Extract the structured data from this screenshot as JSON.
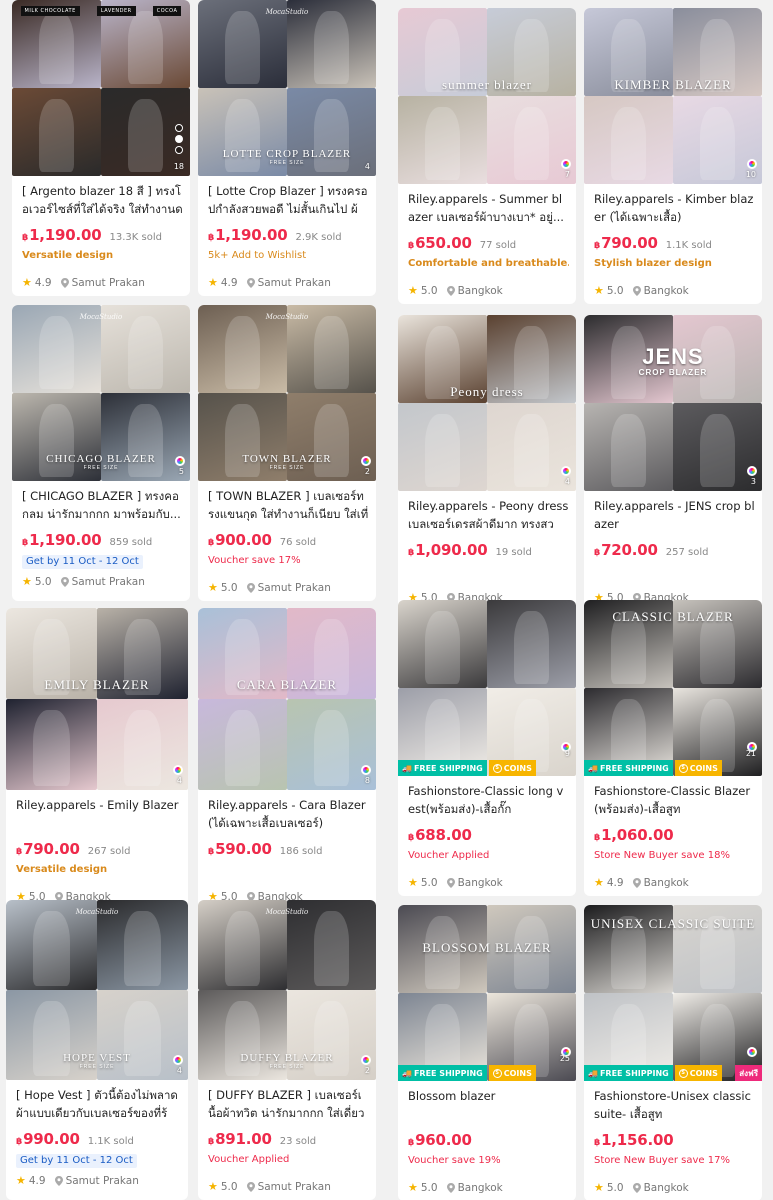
{
  "products": [
    {
      "title": "[ Argento blazer 18 สี ] ทรงโอเวอร์ไซส์ที่ใส่ได้จริง ใส่ทำงานดู...",
      "price_currency": "฿",
      "price": "1,190.00",
      "sold": "13.3K sold",
      "promo": "Versatile design",
      "rating": "4.9",
      "location": "Samut Prakan",
      "img_count": "18",
      "img_tags": [
        "MILK CHOCOLATE",
        "LAVENDER",
        "COCOA"
      ]
    },
    {
      "title": "[ Lotte Crop Blazer ] ทรงครอปกำลังสวยพอดี ไม่สั้นเกินไป ผ้า...",
      "price_currency": "฿",
      "price": "1,190.00",
      "sold": "2.9K sold",
      "promo": "5k+ Add to Wishlist",
      "rating": "4.9",
      "location": "Samut Prakan",
      "img_count": "4",
      "img_brand": "MocaStudio",
      "img_label": "LOTTE CROP BLAZER",
      "img_sub": "FREE SIZE"
    },
    {
      "title": "Riley.apparels - Summer blazer เบลเซอร์ผ้าบางเบา* อยู่...",
      "price_currency": "฿",
      "price": "650.00",
      "sold": "77 sold",
      "promo": "Comfortable and breathable...",
      "rating": "5.0",
      "location": "Bangkok",
      "img_count": "7",
      "img_label": "summer blazer"
    },
    {
      "title": "Riley.apparels - Kimber blazer (ได้เฉพาะเสื้อ)",
      "price_currency": "฿",
      "price": "790.00",
      "sold": "1.1K sold",
      "promo": "Stylish blazer design",
      "rating": "5.0",
      "location": "Bangkok",
      "img_count": "10",
      "img_label": "KIMBER BLAZER"
    },
    {
      "title": "[ CHICAGO BLAZER ] ทรงคอกลม น่ารักมากกก มาพร้อมกับ...",
      "price_currency": "฿",
      "price": "1,190.00",
      "sold": "859 sold",
      "promo": "Get by 11 Oct - 12 Oct",
      "rating": "5.0",
      "location": "Samut Prakan",
      "img_count": "5",
      "img_brand": "MocaStudio",
      "img_label": "CHICAGO BLAZER",
      "img_sub": "FREE SIZE"
    },
    {
      "title": "[ TOWN BLAZER ] เบลเซอร์ทรงแขนกุด ใส่ทำงานก็เนียบ ใส่เที่ยว...",
      "price_currency": "฿",
      "price": "900.00",
      "sold": "76 sold",
      "promo": "Voucher save 17%",
      "rating": "5.0",
      "location": "Samut Prakan",
      "img_count": "2",
      "img_brand": "MocaStudio",
      "img_label": "TOWN BLAZER",
      "img_sub": "FREE SIZE"
    },
    {
      "title": "Riley.apparels - Peony dress เบลเซอร์เดรสผ้าดีมาก ทรงสวย...",
      "price_currency": "฿",
      "price": "1,090.00",
      "sold": "19 sold",
      "promo": "",
      "rating": "5.0",
      "location": "Bangkok",
      "img_count": "4",
      "img_label": "Peony dress"
    },
    {
      "title": "Riley.apparels - JENS crop blazer",
      "price_currency": "฿",
      "price": "720.00",
      "sold": "257 sold",
      "promo": "",
      "rating": "5.0",
      "location": "Bangkok",
      "img_count": "3",
      "img_label": "JENS",
      "img_sub": "CROP BLAZER"
    },
    {
      "title": "Riley.apparels - Emily Blazer",
      "price_currency": "฿",
      "price": "790.00",
      "sold": "267 sold",
      "promo": "Versatile design",
      "rating": "5.0",
      "location": "Bangkok",
      "img_count": "4",
      "img_label": "EMILY BLAZER"
    },
    {
      "title": "Riley.apparels - Cara Blazer (ได้เฉพาะเสื้อเบลเซอร์)",
      "price_currency": "฿",
      "price": "590.00",
      "sold": "186 sold",
      "promo": "",
      "rating": "5.0",
      "location": "Bangkok",
      "img_count": "8",
      "img_label": "CARA BLAZER"
    },
    {
      "title": "Fashionstore-Classic long vest(พร้อมส่ง)-เสื้อกั๊ก",
      "price_currency": "฿",
      "price": "688.00",
      "sold": "",
      "promo": "Voucher Applied",
      "rating": "5.0",
      "location": "Bangkok",
      "img_count": "9",
      "badge_free": "FREE SHIPPING",
      "badge_coins": "COINS"
    },
    {
      "title": "Fashionstore-Classic Blazer(พร้อมส่ง)-เสื้อสูท",
      "price_currency": "฿",
      "price": "1,060.00",
      "sold": "",
      "promo": "Store New Buyer save 18%",
      "rating": "4.9",
      "location": "Bangkok",
      "img_count": "21",
      "img_label": "CLASSIC BLAZER",
      "badge_free": "FREE SHIPPING",
      "badge_coins": "COINS"
    },
    {
      "title": "[ Hope Vest ] ตัวนี้ต้องไม่พลาด ผ้าแบบเดียวกับเบลเซอร์ของที่ร้า...",
      "price_currency": "฿",
      "price": "990.00",
      "sold": "1.1K sold",
      "promo": "Get by 11 Oct - 12 Oct",
      "rating": "4.9",
      "location": "Samut Prakan",
      "img_count": "4",
      "img_brand": "MocaStudio",
      "img_label": "HOPE VEST",
      "img_sub": "FREE SIZE"
    },
    {
      "title": "[ DUFFY BLAZER ] เบลเซอร์เนื้อผ้าทวิต น่ารักมากกก ใส่เดี่ยวๆก็...",
      "price_currency": "฿",
      "price": "891.00",
      "sold": "23 sold",
      "promo": "Voucher Applied",
      "rating": "5.0",
      "location": "Samut Prakan",
      "img_count": "2",
      "img_brand": "MocaStudio",
      "img_label": "DUFFY BLAZER",
      "img_sub": "FREE SIZE"
    },
    {
      "title": "Blossom blazer",
      "price_currency": "฿",
      "price": "960.00",
      "sold": "",
      "promo": "Voucher save 19%",
      "rating": "5.0",
      "location": "Bangkok",
      "img_count": "25",
      "img_label": "BLOSSOM BLAZER",
      "badge_free": "FREE SHIPPING",
      "badge_coins": "COINS"
    },
    {
      "title": "Fashionstore-Unisex classic suite- เสื้อสูท",
      "price_currency": "฿",
      "price": "1,156.00",
      "sold": "",
      "promo": "Store New Buyer save 17%",
      "rating": "5.0",
      "location": "Bangkok",
      "img_count": "",
      "img_label": "UNISEX CLASSIC SUITE",
      "badge_free": "FREE SHIPPING",
      "badge_coins": "COINS",
      "badge_new": "ส่งฟรี"
    }
  ],
  "colors": {
    "price": "#ee2a4b",
    "promo_orange": "#d98a1c",
    "promo_blue": "#1a5cc4",
    "star": "#f5b400",
    "free_shipping": "#00bfa5",
    "coins": "#f7b500"
  },
  "icons": {
    "star": "star-icon",
    "location": "location-pin-icon",
    "truck": "truck-icon",
    "coin": "coin-icon",
    "album": "album-icon"
  }
}
